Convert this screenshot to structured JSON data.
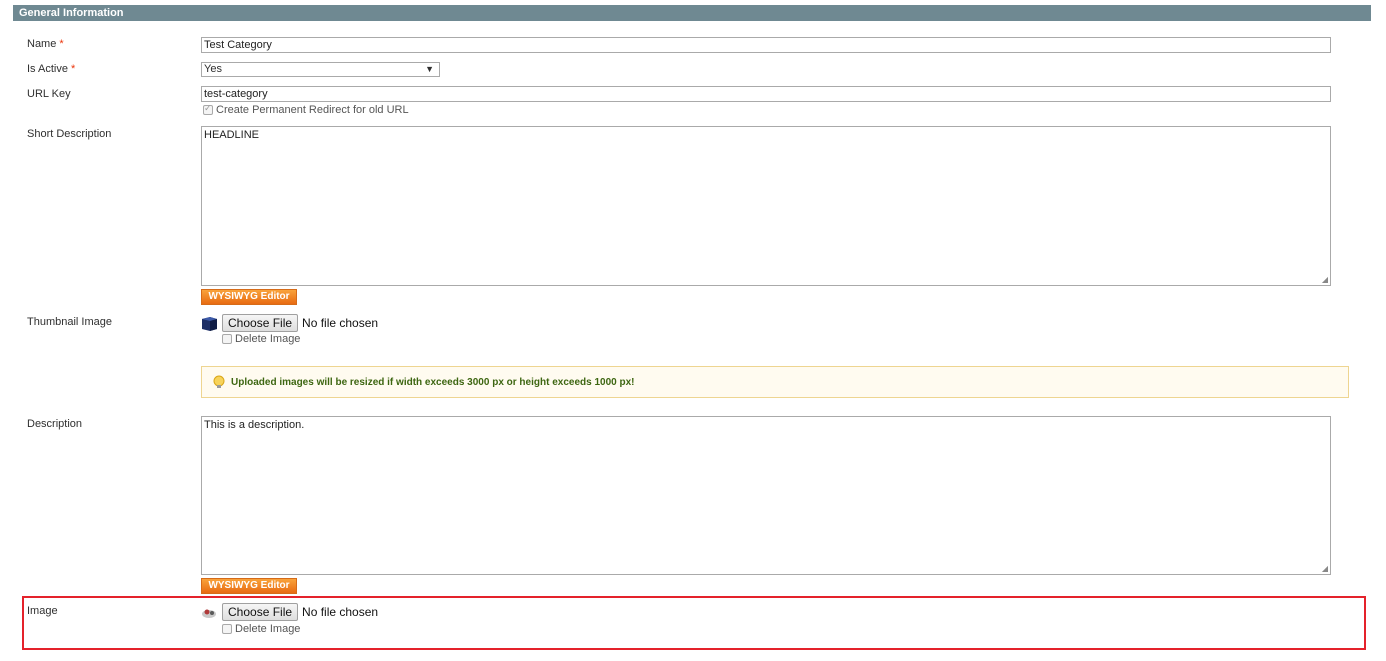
{
  "section_title": "General Information",
  "fields": {
    "name": {
      "label": "Name",
      "required_mark": "*",
      "value": "Test Category"
    },
    "is_active": {
      "label": "Is Active",
      "required_mark": "*",
      "value": "Yes"
    },
    "url_key": {
      "label": "URL Key",
      "value": "test-category",
      "redirect_label": "Create Permanent Redirect for old URL",
      "redirect_checked": true
    },
    "short_description": {
      "label": "Short Description",
      "value": "HEADLINE",
      "wysiwyg_label": "WYSIWYG Editor"
    },
    "thumbnail": {
      "label": "Thumbnail Image",
      "button_label": "Choose File",
      "status": "No file chosen",
      "delete_label": "Delete Image",
      "icon": "thumbnail-cube-icon"
    },
    "notice": {
      "text": "Uploaded images will be resized if width exceeds 3000 px or height exceeds 1000 px!",
      "icon": "lightbulb-icon"
    },
    "description": {
      "label": "Description",
      "value": "This is a description.",
      "wysiwyg_label": "WYSIWYG Editor"
    },
    "image": {
      "label": "Image",
      "button_label": "Choose File",
      "status": "No file chosen",
      "delete_label": "Delete Image",
      "icon": "image-thumb-icon"
    }
  },
  "colors": {
    "header_bg": "#6f8992",
    "required": "#eb340a",
    "button_orange": "#f28a23",
    "highlight_border": "#e4222b"
  }
}
